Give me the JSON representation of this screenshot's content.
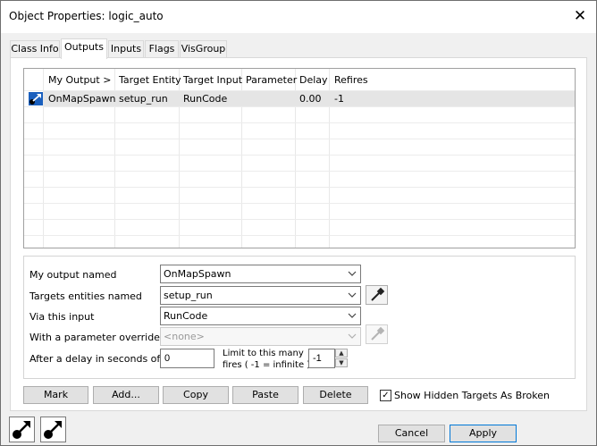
{
  "window": {
    "title": "Object Properties: logic_auto",
    "close_glyph": "✕"
  },
  "tabs": [
    {
      "label": "Class Info",
      "active": false
    },
    {
      "label": "Outputs",
      "active": true
    },
    {
      "label": "Inputs",
      "active": false
    },
    {
      "label": "Flags",
      "active": false
    },
    {
      "label": "VisGroup",
      "active": false
    }
  ],
  "grid": {
    "columns": [
      "My Output  >",
      "Target Entity",
      "Target Input",
      "Parameter",
      "Delay",
      "Refires"
    ],
    "rows": [
      {
        "icon": "output-connection-icon",
        "cells": [
          "OnMapSpawn",
          "setup_run",
          "RunCode",
          "",
          "0.00",
          "-1"
        ]
      }
    ]
  },
  "form": {
    "output_label": "My output named",
    "output_value": "OnMapSpawn",
    "target_label": "Targets entities named",
    "target_value": "setup_run",
    "input_label": "Via this input",
    "input_value": "RunCode",
    "param_label": "With a parameter override of",
    "param_value": "<none>",
    "delay_label": "After a delay in seconds of",
    "delay_value": "0",
    "limit_label_1": "Limit to this many",
    "limit_label_2": "fires ( -1 = infinite )",
    "limit_value": "-1"
  },
  "buttons": {
    "mark": "Mark",
    "add": "Add...",
    "copy": "Copy",
    "paste": "Paste",
    "delete": "Delete",
    "show_hidden": "Show Hidden Targets As Broken",
    "cancel": "Cancel",
    "apply": "Apply"
  },
  "colors": {
    "accent": "#0078d7",
    "selected_row": "#e5e5e5",
    "icon_blue": "#1a5fbd"
  }
}
